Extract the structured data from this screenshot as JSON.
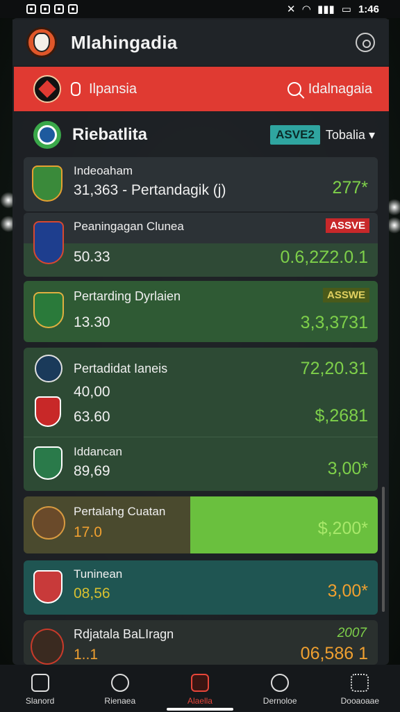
{
  "status": {
    "time": "1:46"
  },
  "header": {
    "title": "Mlahingadia"
  },
  "red_bar": {
    "label": "Ilpansia",
    "search_label": "Idalnagaia"
  },
  "section": {
    "title": "Riebatlita",
    "filter_badge": "ASVE2",
    "dropdown_label": "Tobalia"
  },
  "colors": {
    "accent_red": "#e03a32",
    "green_value": "#7ed04a",
    "orange_value": "#f0a030",
    "teal": "#2fa5a0"
  },
  "cards": [
    {
      "title": "Indeoaham",
      "subtitle": "31,363 - Pertandagik (j)",
      "value": "277*"
    },
    {
      "title": "Peaningagan Clunea",
      "subtitle": "50.33",
      "value": "0.6,2Z2.0.1",
      "badge": "ASSVE"
    },
    {
      "title": "Pertarding Dyrlaien",
      "subtitle": "13.30",
      "value": "3,3,3731",
      "badge": "ASSWE"
    },
    {
      "title": "Pertadidat Ianeis",
      "subtitle": "40,00",
      "value": "72,20.31"
    },
    {
      "title": "",
      "subtitle": "63.60",
      "value": "$,2681"
    },
    {
      "title": "Iddancan",
      "subtitle": "89,69",
      "value": "3,00*"
    },
    {
      "title": "Pertalahg Cuatan",
      "subtitle": "17.0",
      "value": "$,200*"
    },
    {
      "title": "Tuninean",
      "subtitle": "08,56",
      "value": "3,00*"
    },
    {
      "title": "Rdjatala BaLIragn",
      "subtitle": "1..1",
      "value": "06,586 1",
      "top_value": "2007"
    }
  ],
  "tabs": [
    {
      "label": "Slanord",
      "icon": "home-icon"
    },
    {
      "label": "Rienaea",
      "icon": "search-icon"
    },
    {
      "label": "Alaella",
      "icon": "live-icon"
    },
    {
      "label": "Dernoloe",
      "icon": "refresh-icon"
    },
    {
      "label": "Dooaoaae",
      "icon": "grid-icon"
    }
  ]
}
